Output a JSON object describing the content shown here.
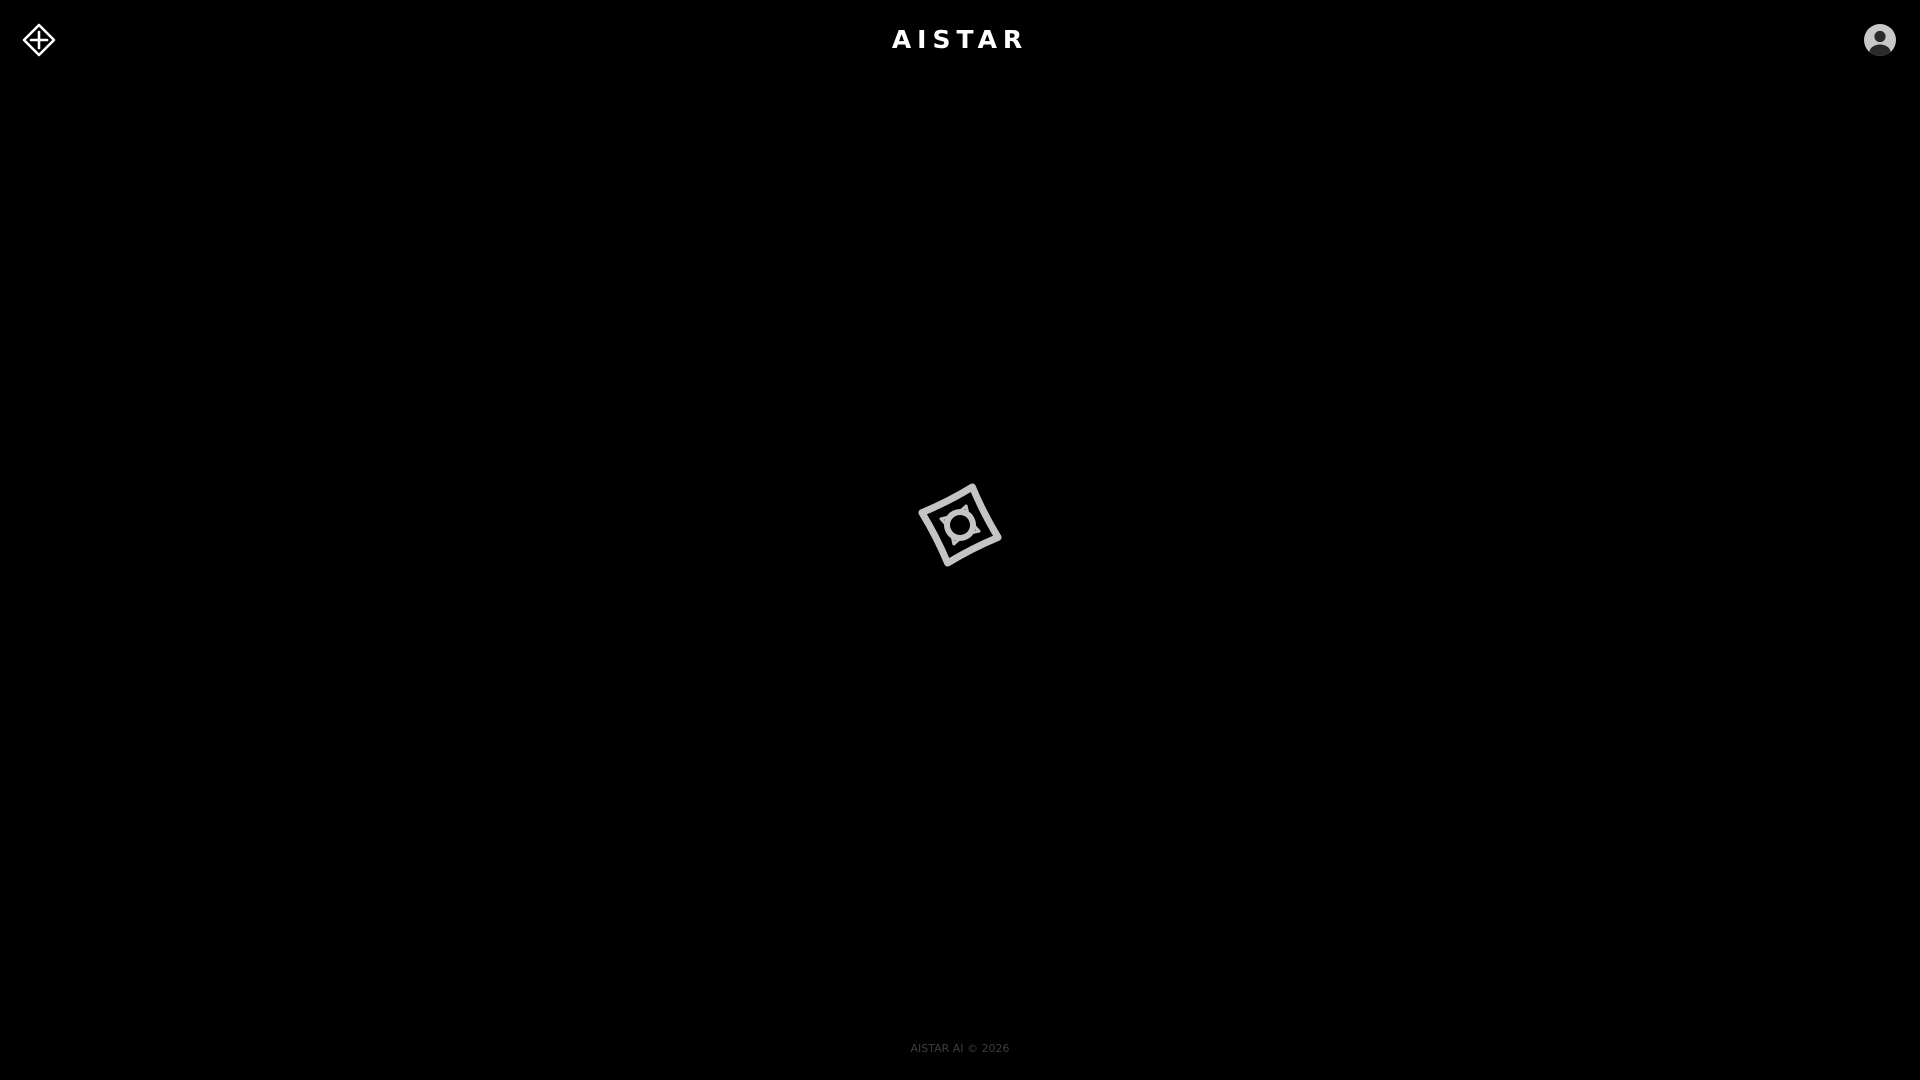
{
  "header": {
    "menu_icon": "diamond-crosshair-icon",
    "title": "AISTAR",
    "profile_icon": "user-avatar-icon"
  },
  "main": {
    "loader_icon": "spinning-star-icon"
  },
  "footer": {
    "copyright": "AISTAR AI © 2026"
  },
  "colors": {
    "background": "#000000",
    "title": "#ffffff",
    "loader": "#c4c4c4",
    "avatar": "#c8c8c8",
    "footer_text": "#3d3d3d"
  }
}
